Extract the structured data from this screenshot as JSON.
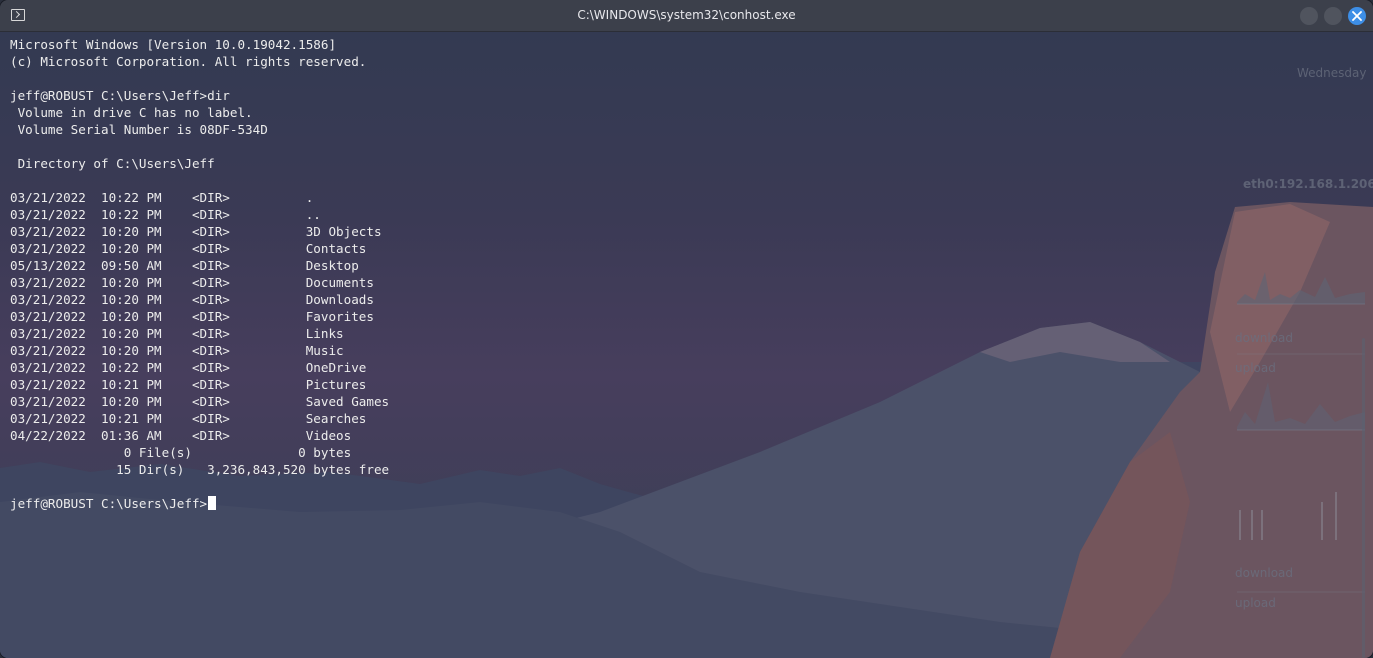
{
  "window": {
    "title": "C:\\WINDOWS\\system32\\conhost.exe"
  },
  "console": {
    "lines": [
      "Microsoft Windows [Version 10.0.19042.1586]",
      "(c) Microsoft Corporation. All rights reserved.",
      "",
      "jeff@ROBUST C:\\Users\\Jeff>dir",
      " Volume in drive C has no label.",
      " Volume Serial Number is 08DF-534D",
      "",
      " Directory of C:\\Users\\Jeff",
      "",
      "03/21/2022  10:22 PM    <DIR>          .",
      "03/21/2022  10:22 PM    <DIR>          ..",
      "03/21/2022  10:20 PM    <DIR>          3D Objects",
      "03/21/2022  10:20 PM    <DIR>          Contacts",
      "05/13/2022  09:50 AM    <DIR>          Desktop",
      "03/21/2022  10:20 PM    <DIR>          Documents",
      "03/21/2022  10:20 PM    <DIR>          Downloads",
      "03/21/2022  10:20 PM    <DIR>          Favorites",
      "03/21/2022  10:20 PM    <DIR>          Links",
      "03/21/2022  10:20 PM    <DIR>          Music",
      "03/21/2022  10:22 PM    <DIR>          OneDrive",
      "03/21/2022  10:21 PM    <DIR>          Pictures",
      "03/21/2022  10:20 PM    <DIR>          Saved Games",
      "03/21/2022  10:21 PM    <DIR>          Searches",
      "04/22/2022  01:36 AM    <DIR>          Videos",
      "               0 File(s)              0 bytes",
      "              15 Dir(s)   3,236,843,520 bytes free",
      ""
    ],
    "prompt": "jeff@ROBUST C:\\Users\\Jeff>"
  },
  "desktop_widget": {
    "day": "Wednesday",
    "network_label": "eth0:192.168.1.206",
    "download_label_1": "download",
    "upload_label_1": "upload",
    "download_label_2": "download",
    "upload_label_2": "upload"
  },
  "colors": {
    "titlebar": "#3c404b",
    "close_button": "#3d8ee6",
    "console_text": "#ececec"
  }
}
